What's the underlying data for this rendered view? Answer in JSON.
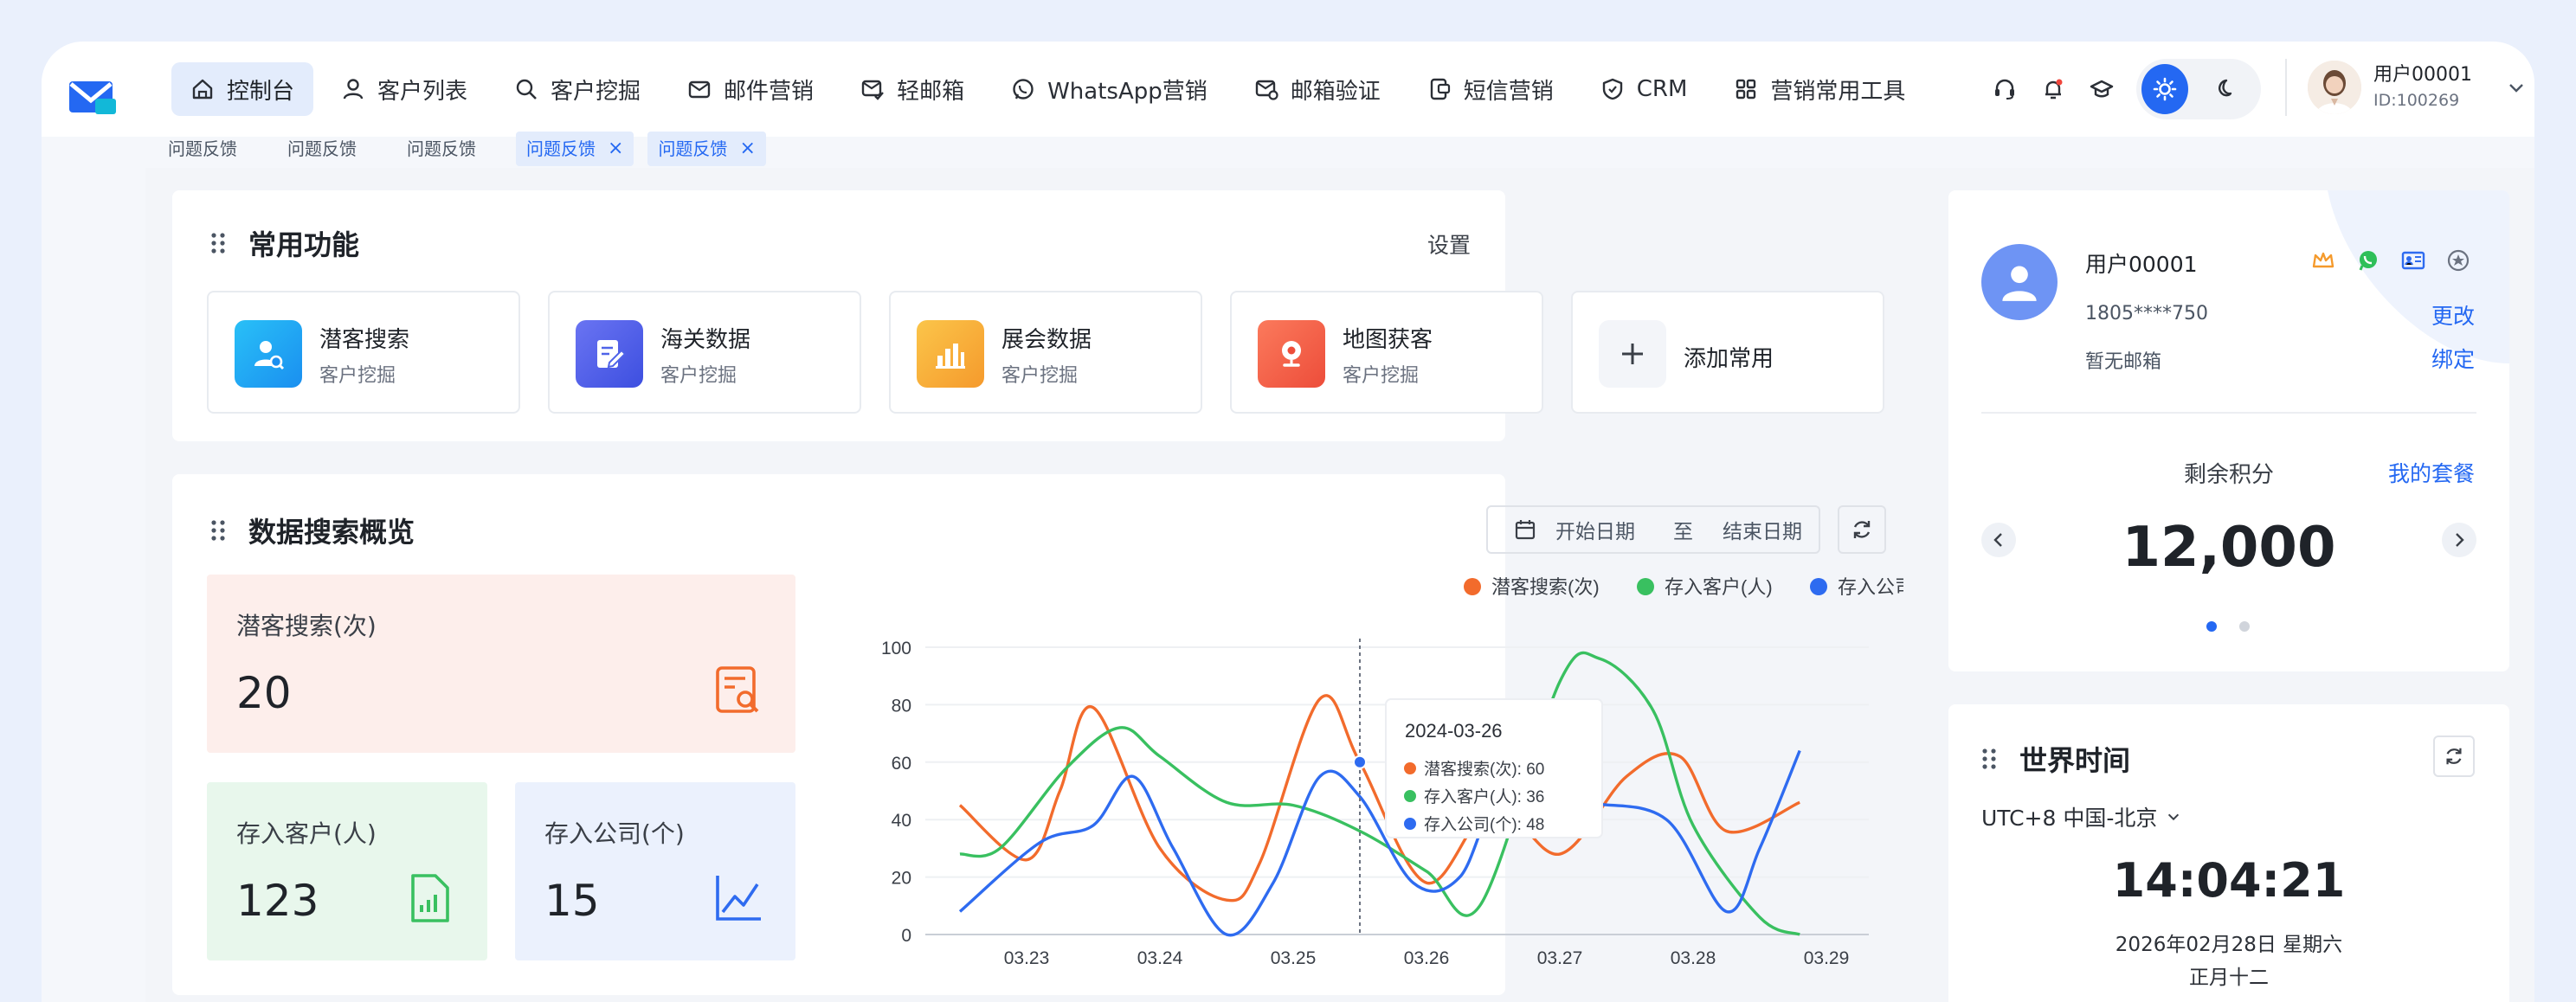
{
  "nav": {
    "items": [
      {
        "label": "控制台",
        "active": true
      },
      {
        "label": "客户列表"
      },
      {
        "label": "客户挖掘"
      },
      {
        "label": "邮件营销"
      },
      {
        "label": "轻邮箱"
      },
      {
        "label": "WhatsApp营销"
      },
      {
        "label": "邮箱验证"
      },
      {
        "label": "短信营销"
      },
      {
        "label": "CRM"
      },
      {
        "label": "营销常用工具"
      }
    ]
  },
  "user": {
    "name": "用户00001",
    "id": "ID:100269"
  },
  "tags": [
    "问题反馈",
    "问题反馈",
    "问题反馈",
    "问题反馈",
    "问题反馈"
  ],
  "common": {
    "title": "常用功能",
    "settings": "设置",
    "items": [
      {
        "title": "潜客搜索",
        "sub": "客户挖掘",
        "icon": "user-search-icon",
        "color": "#1aa5f0"
      },
      {
        "title": "海关数据",
        "sub": "客户挖掘",
        "icon": "document-edit-icon",
        "color": "#4f63e8"
      },
      {
        "title": "展会数据",
        "sub": "客户挖掘",
        "icon": "bar-chart-icon",
        "color": "#f7a43a"
      },
      {
        "title": "地图获客",
        "sub": "客户挖掘",
        "icon": "map-pin-icon",
        "color": "#f0624a"
      }
    ],
    "add_label": "添加常用"
  },
  "overview": {
    "title": "数据搜索概览",
    "start_placeholder": "开始日期",
    "to": "至",
    "end_placeholder": "结束日期",
    "stats": [
      {
        "label": "潜客搜索(次)",
        "value": "20"
      },
      {
        "label": "存入客户(人)",
        "value": "123"
      },
      {
        "label": "存入公司(个)",
        "value": "15"
      }
    ]
  },
  "chart_data": {
    "type": "line",
    "title": "",
    "xlabel": "",
    "ylabel": "",
    "ylim": [
      0,
      100
    ],
    "yticks": [
      0,
      20,
      40,
      60,
      80,
      100
    ],
    "x": [
      "03.23",
      "03.24",
      "03.25",
      "03.26",
      "03.27",
      "03.28",
      "03.29"
    ],
    "legend_position": "top-right",
    "grid": true,
    "series": [
      {
        "name": "潜客搜索(次)",
        "color": "#f26b2c",
        "values": [
          [
            0,
            45
          ],
          [
            0.5,
            26
          ],
          [
            0.75,
            50
          ],
          [
            1.0,
            79
          ],
          [
            1.5,
            30
          ],
          [
            2.0,
            12
          ],
          [
            2.25,
            25
          ],
          [
            2.7,
            82
          ],
          [
            3.0,
            60
          ],
          [
            3.5,
            18
          ],
          [
            4.0,
            45
          ],
          [
            4.5,
            28
          ],
          [
            5.0,
            55
          ],
          [
            5.4,
            62
          ],
          [
            5.75,
            36
          ],
          [
            6.3,
            46
          ]
        ]
      },
      {
        "name": "存入客户(人)",
        "color": "#39c060",
        "values": [
          [
            0,
            28
          ],
          [
            0.3,
            30
          ],
          [
            0.8,
            58
          ],
          [
            1.2,
            72
          ],
          [
            1.5,
            62
          ],
          [
            2.0,
            46
          ],
          [
            2.5,
            45
          ],
          [
            3.0,
            36
          ],
          [
            3.5,
            22
          ],
          [
            3.9,
            10
          ],
          [
            4.5,
            88
          ],
          [
            4.8,
            96
          ],
          [
            5.2,
            78
          ],
          [
            5.5,
            38
          ],
          [
            6.0,
            6
          ],
          [
            6.3,
            0
          ]
        ]
      },
      {
        "name": "存入公司(个)",
        "color": "#2e6bf0",
        "values": [
          [
            0,
            8
          ],
          [
            0.6,
            32
          ],
          [
            1.0,
            38
          ],
          [
            1.3,
            55
          ],
          [
            1.6,
            30
          ],
          [
            2.0,
            0
          ],
          [
            2.35,
            18
          ],
          [
            2.7,
            55
          ],
          [
            3.0,
            48
          ],
          [
            3.4,
            18
          ],
          [
            3.75,
            20
          ],
          [
            4.1,
            52
          ],
          [
            4.7,
            46
          ],
          [
            5.3,
            40
          ],
          [
            5.75,
            8
          ],
          [
            6.0,
            30
          ],
          [
            6.3,
            64
          ]
        ]
      }
    ],
    "tooltip": {
      "date": "2024-03-26",
      "lines": [
        "潜客搜索(次): 60",
        "存入客户(人): 36",
        "存入公司(个): 48"
      ]
    }
  },
  "account": {
    "name": "用户00001",
    "phone": "1805****750",
    "email": "暂无邮箱",
    "change": "更改",
    "bind": "绑定",
    "points_label": "剩余积分",
    "plan_link": "我的套餐",
    "points": "12,000"
  },
  "world_time": {
    "title": "世界时间",
    "zone": "UTC+8 中国-北京",
    "time": "14:04:21",
    "date": "2026年02月28日 星期六",
    "lunar": "正月十二"
  }
}
